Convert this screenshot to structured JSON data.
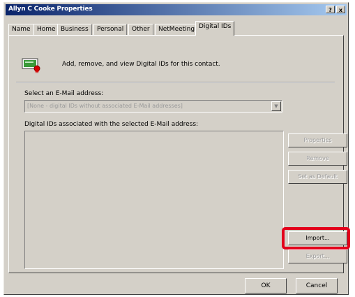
{
  "window": {
    "title": "Allyn C Cooke Properties",
    "help_button": "?",
    "close_button": "x"
  },
  "tabs": [
    {
      "label": "Name",
      "active": false
    },
    {
      "label": "Home",
      "active": false
    },
    {
      "label": "Business",
      "active": false
    },
    {
      "label": "Personal",
      "active": false
    },
    {
      "label": "Other",
      "active": false
    },
    {
      "label": "NetMeeting",
      "active": false
    },
    {
      "label": "Digital IDs",
      "active": true
    }
  ],
  "panel": {
    "intro_text": "Add, remove, and view Digital IDs for this contact.",
    "select_label": "Select an E-Mail address:",
    "select_value": "[None - digital IDs without associated E-Mail addresses]",
    "list_label": "Digital IDs associated with the selected E-Mail address:",
    "buttons": {
      "properties": "Properties",
      "remove": "Remove",
      "set_default": "Set as Default",
      "import": "Import...",
      "export": "Export..."
    }
  },
  "footer": {
    "ok": "OK",
    "cancel": "Cancel"
  },
  "colors": {
    "highlight": "#e3001b",
    "titlebar_start": "#0a246a",
    "face": "#d4d0c8"
  }
}
